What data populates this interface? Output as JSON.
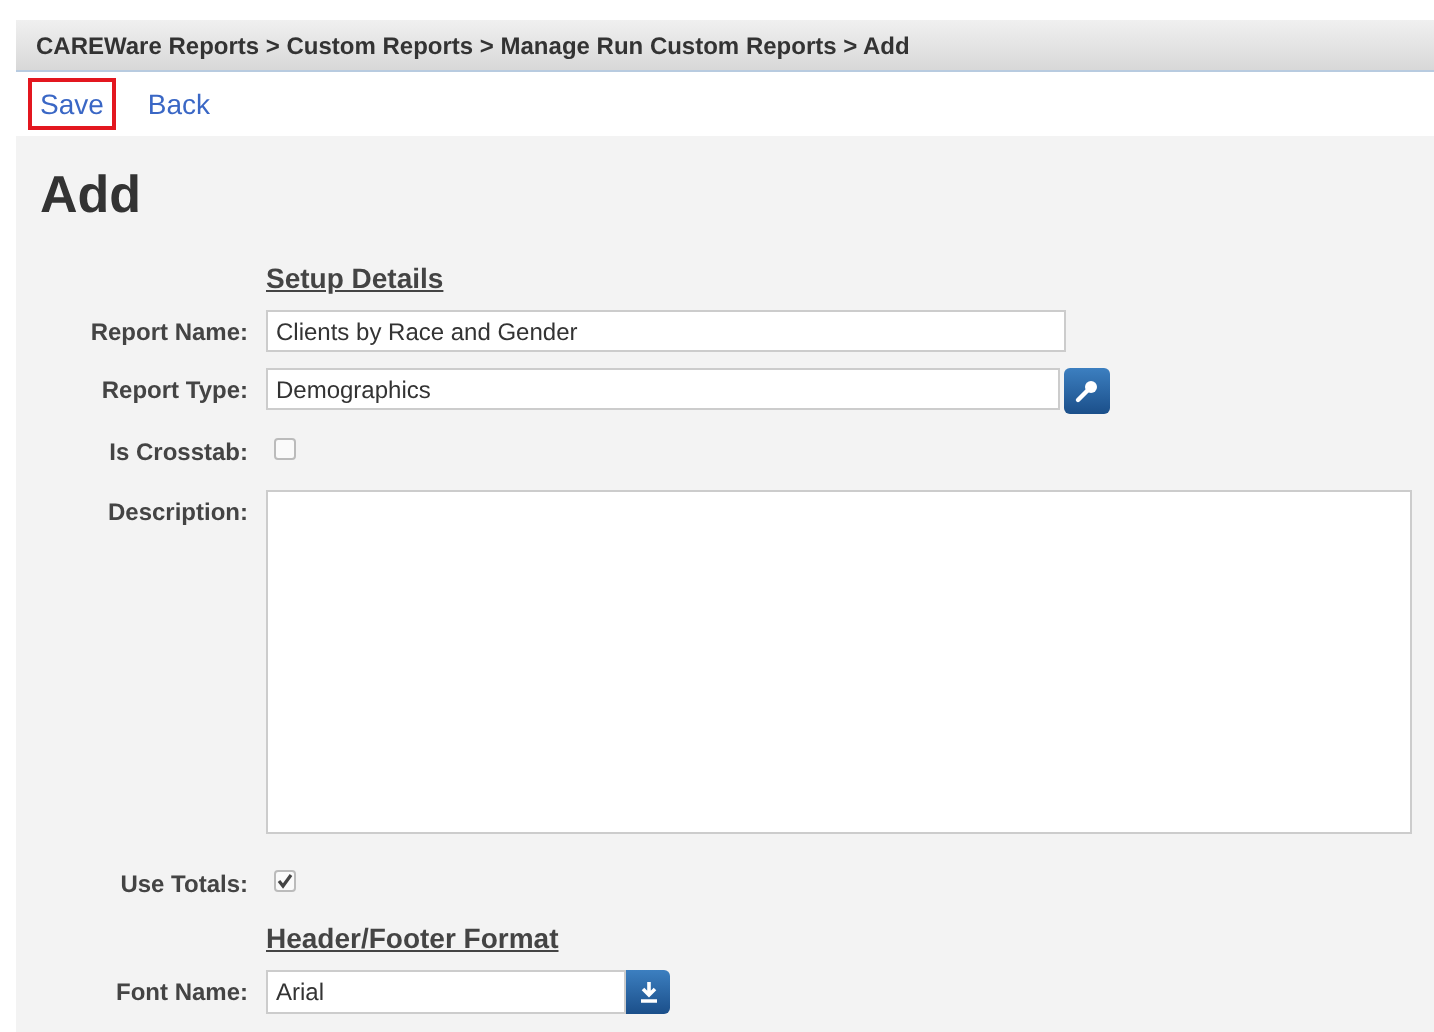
{
  "breadcrumb": "CAREWare Reports > Custom Reports > Manage Run Custom Reports > Add",
  "toolbar": [
    {
      "label": "Save",
      "selected": true
    },
    {
      "label": "Back",
      "selected": false
    }
  ],
  "title": "Add",
  "sections": [
    {
      "heading": "Setup Details",
      "fields": [
        {
          "kind": "text",
          "label": "Report Name:",
          "value": "Clients by Race and Gender"
        },
        {
          "kind": "lookup",
          "label": "Report Type:",
          "value": "Demographics"
        },
        {
          "kind": "checkbox",
          "label": "Is Crosstab:",
          "checked": false
        },
        {
          "kind": "textarea",
          "label": "Description:"
        },
        {
          "kind": "checkbox",
          "label": "Use Totals:",
          "checked": true
        }
      ]
    },
    {
      "heading": "Header/Footer Format",
      "fields": [
        {
          "kind": "select",
          "label": "Font Name:",
          "value": "Arial"
        }
      ]
    }
  ]
}
